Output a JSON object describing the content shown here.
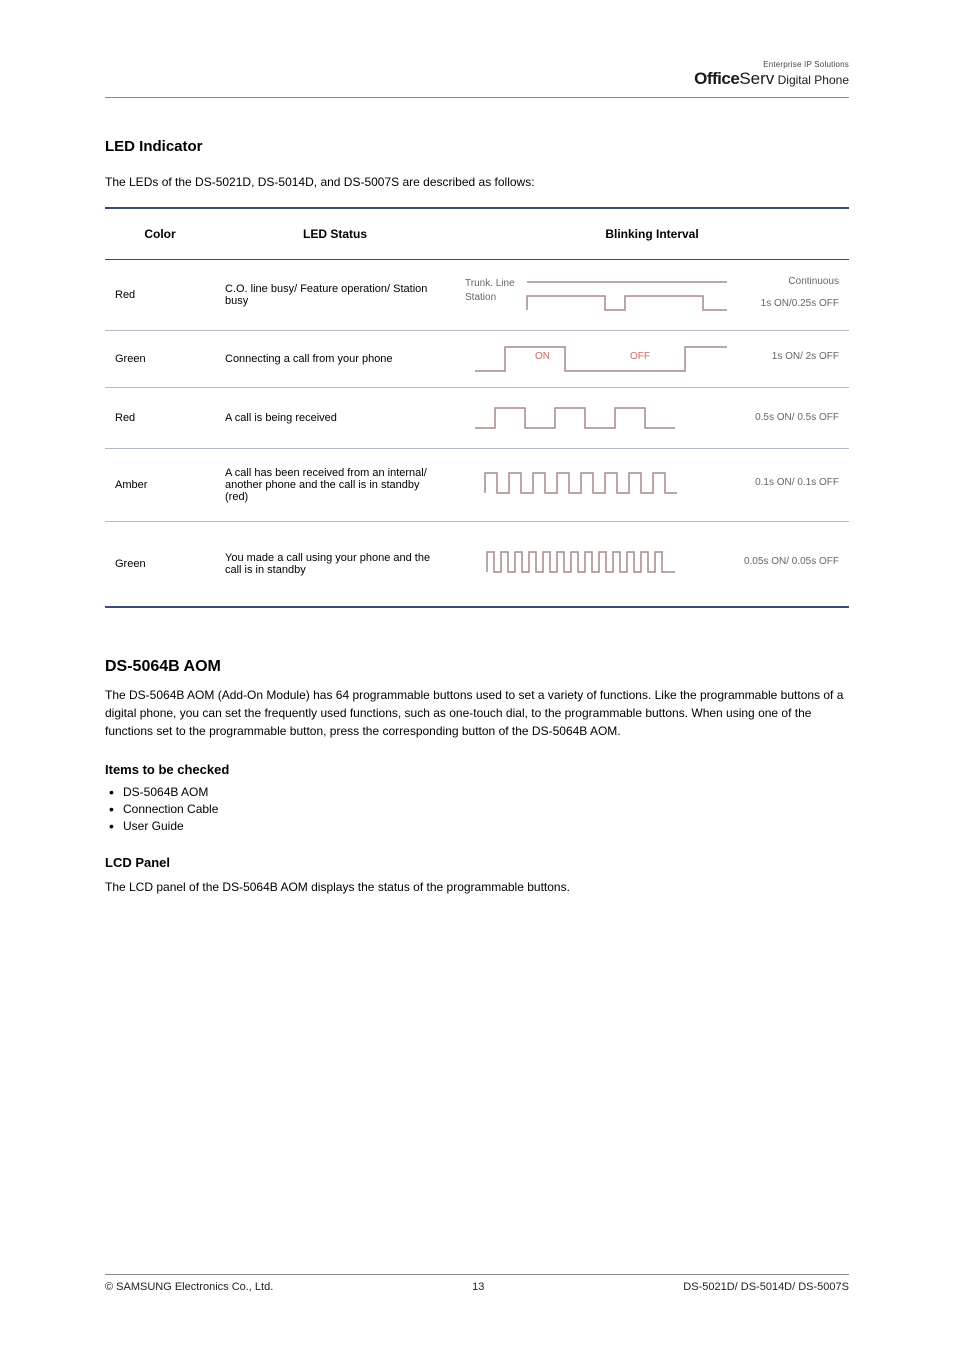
{
  "brand": {
    "top": "Enterprise IP Solutions",
    "office": "Office",
    "serv": "Serv",
    "dp": " Digital Phone"
  },
  "section": {
    "title": "LED Indicator",
    "note": "The LEDs of the DS-5021D, DS-5014D, and DS-5007S are described as follows:"
  },
  "table": {
    "headers": [
      "Color",
      "LED Status",
      "Blinking Interval"
    ],
    "rows": [
      {
        "color": "Red",
        "status": "C.O. line busy/ Feature operation/ Station busy",
        "wave_left": [
          "Trunk. Line",
          "Station"
        ],
        "wave_right": [
          "Continuous",
          "1s ON/0.25s OFF"
        ]
      },
      {
        "color": "Green",
        "status": "Connecting a call from your phone",
        "wave_mid": [
          "ON",
          "OFF"
        ],
        "wave_right": [
          "1s ON/ 2s OFF"
        ]
      },
      {
        "color": "Red",
        "status": "A call is being received",
        "wave_right": [
          "0.5s ON/ 0.5s OFF"
        ]
      },
      {
        "color": "Amber",
        "status": "A call has been received from an internal/ another phone and the call is in standby (red)",
        "wave_right": [
          "0.1s ON/ 0.1s OFF"
        ]
      },
      {
        "color": "Green",
        "status": "You made a call using your phone and the call is in standby",
        "wave_right": [
          "0.05s ON/ 0.05s OFF"
        ]
      }
    ]
  },
  "addon": {
    "title": "DS-5064B AOM",
    "text": "The DS-5064B AOM (Add-On Module) has 64 programmable buttons used to set a variety of functions. Like the programmable buttons of a digital phone, you can set the frequently used functions, such as one-touch dial, to the programmable buttons. When using one of the functions set to the programmable button, press the corresponding button of the DS-5064B AOM.",
    "items_label": "Items to be checked",
    "items": [
      "DS-5064B AOM",
      "Connection Cable",
      "User Guide"
    ],
    "lcd_h": "LCD Panel",
    "lcd_text": "The LCD panel of the DS-5064B AOM displays the status of the programmable buttons."
  },
  "footer": {
    "copyright": "© SAMSUNG Electronics Co., Ltd.",
    "page": "13",
    "model": "DS-5021D/ DS-5014D/ DS-5007S"
  }
}
